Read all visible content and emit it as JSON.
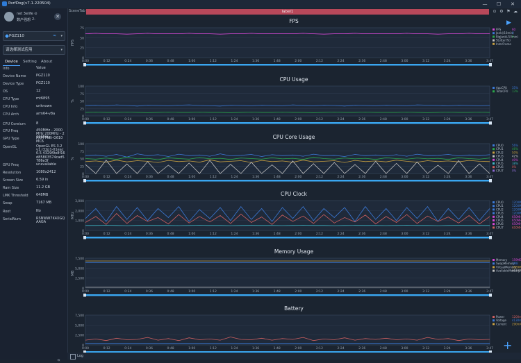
{
  "window": {
    "title": "PerfDog(v7.1.220504)",
    "minimize": "—",
    "maximize": "☐",
    "close": "✕"
  },
  "profile": {
    "name": "net 3elife ⊙",
    "sub": "数户强想 ",
    "right_mark": "2-",
    "close": "✕"
  },
  "device_select": {
    "value": "PGZ110",
    "dropdown": "▾"
  },
  "app_select": {
    "value": "请选择测试应用",
    "dropdown": "▾"
  },
  "tabs": [
    "Device",
    "Setting",
    "About"
  ],
  "info": {
    "header": {
      "k": "Info",
      "v": "Value"
    },
    "rows": [
      {
        "k": "Device Name",
        "v": "PGZ110"
      },
      {
        "k": "Device Type",
        "v": "PGZ110"
      },
      {
        "k": "OS",
        "v": "12"
      },
      {
        "k": "CPU Type",
        "v": "mt6895"
      },
      {
        "k": "CPU Info",
        "v": "unknown"
      },
      {
        "k": "CPU Arch",
        "v": "arm64-v8a"
      },
      {
        "k": "CPU Coreium",
        "v": "8"
      },
      {
        "k": "CPU Freq",
        "v": "450MHz - 2000MHz 200MHz - 2600MHz"
      },
      {
        "k": "GPU Type",
        "v": "ARM Mali-G610 MC6"
      },
      {
        "k": "OpenGL",
        "v": "OpenGL ES 3.2 v1.r32p1-01eac0.5 4329f9e8f16d85803574cad5786e3f"
      },
      {
        "k": "GPU Freq",
        "v": "unavailable"
      },
      {
        "k": "Resolution",
        "v": "1080x2412"
      },
      {
        "k": "Screen Size",
        "v": "6.59 in"
      },
      {
        "k": "Ram Size",
        "v": "11.2 GB"
      },
      {
        "k": "LMK Threshold",
        "v": "648MB"
      },
      {
        "k": "Swap",
        "v": "7167 MB"
      },
      {
        "k": "Root",
        "v": "No"
      },
      {
        "k": "SerialNum",
        "v": "RSNWW7K4XGQAAGA"
      }
    ]
  },
  "scene": {
    "label": "SceneTab",
    "bar_label": "label1"
  },
  "log": {
    "label": "Log"
  },
  "icons": {
    "play": "play-icon",
    "add": "add-icon",
    "collapse": "double-chevron-left-icon"
  },
  "time_ticks": [
    "0:00",
    "0:12",
    "0:24",
    "0:36",
    "0:48",
    "1:00",
    "1:12",
    "1:24",
    "1:36",
    "1:48",
    "2:00",
    "2:12",
    "2:24",
    "2:36",
    "2:48",
    "3:00",
    "3:12",
    "3:24",
    "3:36",
    "3:47"
  ],
  "charts": [
    {
      "title": "FPS",
      "ylabel": "FPS",
      "yticks": [
        "75",
        "50",
        "25",
        "0"
      ],
      "ymax": 75,
      "colors": [
        "#d648d6",
        "#3c7ad8",
        "#2aa84a"
      ],
      "series_values": [
        [
          60,
          61,
          60,
          60,
          59,
          60,
          61,
          60,
          60,
          60,
          61,
          60,
          60,
          59,
          60,
          60,
          61,
          60,
          60,
          60,
          60,
          61,
          60,
          59,
          60,
          60,
          61,
          60,
          60,
          60,
          60,
          61,
          60,
          60,
          59,
          60,
          60,
          61,
          60,
          60
        ]
      ],
      "legend": [
        "FPS",
        "Jank(/10min)",
        "BigJank(/10min)",
        "Stutter(%)",
        "InterFrame"
      ],
      "legend_colors": [
        "#d648d6",
        "#3c7ad8",
        "#2aa84a",
        "#c0c0c0",
        "#c8a040"
      ],
      "right_values": [
        "60",
        "0",
        "0"
      ]
    },
    {
      "title": "CPU Usage",
      "ylabel": "%",
      "yticks": [
        "100",
        "75",
        "50",
        "25",
        "0"
      ],
      "ymax": 100,
      "colors": [
        "#3c7ad8",
        "#2aa84a"
      ],
      "series_values": [
        [
          35,
          36,
          34,
          37,
          35,
          33,
          36,
          35,
          34,
          36,
          37,
          35,
          34,
          33,
          36,
          35,
          34,
          36,
          35,
          34,
          37,
          35,
          34,
          36,
          35,
          33,
          36,
          35,
          34,
          36,
          35,
          34,
          37,
          36,
          35,
          34,
          36,
          35,
          34,
          35
        ],
        [
          12,
          13,
          12,
          12,
          13,
          12,
          11,
          12,
          13,
          12,
          12,
          13,
          12,
          12,
          11,
          12,
          13,
          12,
          12,
          13,
          12,
          12,
          11,
          12,
          13,
          12,
          12,
          13,
          12,
          12,
          12,
          13,
          12,
          11,
          12,
          13,
          12,
          12,
          13,
          12
        ]
      ],
      "legend": [
        "AppCPU",
        "TotalCPU"
      ],
      "legend_colors": [
        "#3c7ad8",
        "#2aa84a"
      ],
      "right_values": [
        "35%",
        "13%"
      ]
    },
    {
      "title": "CPU Core Usage",
      "ylabel": "%",
      "yticks": [
        "100",
        "75",
        "50",
        "25",
        "0"
      ],
      "ymax": 100,
      "colors": [
        "#3c7ad8",
        "#2aa84a",
        "#c8a040",
        "#c0c0c0",
        "#d648d6",
        "#3fb8c8",
        "#d06060",
        "#8a6ad0"
      ],
      "series_values": [
        [
          60,
          62,
          58,
          64,
          55,
          66,
          60,
          63,
          57,
          65,
          60,
          62,
          58,
          66,
          59,
          61,
          64,
          57,
          63,
          60,
          62,
          58,
          65,
          60,
          61,
          57,
          64,
          60,
          62,
          59,
          63,
          58,
          65,
          60,
          61,
          64,
          59,
          62,
          60,
          63
        ],
        [
          50,
          48,
          52,
          47,
          55,
          49,
          51,
          46,
          53,
          50,
          48,
          54,
          49,
          51,
          47,
          52,
          50,
          48,
          53,
          49,
          51,
          47,
          55,
          50,
          48,
          52,
          49,
          51,
          47,
          53,
          50,
          48,
          52,
          49,
          51,
          47,
          53,
          50,
          48,
          52
        ],
        [
          40,
          42,
          38,
          45,
          39,
          43,
          41,
          37,
          44,
          40,
          42,
          38,
          46,
          39,
          41,
          43,
          37,
          44,
          40,
          42,
          38,
          45,
          39,
          41,
          43,
          37,
          44,
          40,
          42,
          39,
          45,
          41,
          38,
          43,
          40,
          42,
          39,
          44,
          41,
          40
        ],
        [
          30,
          0,
          45,
          0,
          32,
          0,
          40,
          0,
          28,
          0,
          35,
          0,
          44,
          0,
          31,
          0,
          38,
          0,
          29,
          0,
          42,
          0,
          33,
          0,
          37,
          0,
          30,
          0,
          41,
          0,
          34,
          0,
          39,
          0,
          28,
          0,
          43,
          0,
          32,
          0
        ]
      ],
      "legend": [
        "CPU0",
        "CPU1",
        "CPU2",
        "CPU3",
        "CPU4",
        "CPU5",
        "CPU6",
        "CPU7"
      ],
      "legend_colors": [
        "#3c7ad8",
        "#2aa84a",
        "#c8a040",
        "#c0c0c0",
        "#d648d6",
        "#3fb8c8",
        "#d06060",
        "#8a6ad0"
      ],
      "right_values": [
        "56%",
        "46%",
        "50%",
        "42%",
        "40%",
        "38%",
        "0%",
        "0%"
      ]
    },
    {
      "title": "CPU Clock",
      "ylabel": "MHz",
      "yticks": [
        "3,000",
        "2,000",
        "1,000",
        "0"
      ],
      "ymax": 3000,
      "colors": [
        "#3c7ad8",
        "#d06060",
        "#3fb8c8",
        "#c0c0c0"
      ],
      "series_values": [
        [
          1200,
          2200,
          900,
          2400,
          1100,
          2300,
          1000,
          2200,
          1300,
          2400,
          900,
          2100,
          1200,
          2300,
          1000,
          2400,
          1100,
          2200,
          900,
          2300,
          1200,
          2400,
          1000,
          2200,
          1300,
          2300,
          900,
          2400,
          1100,
          2200,
          1000,
          2300,
          1200,
          2400,
          900,
          2200,
          1100,
          2300,
          1000,
          2200
        ],
        [
          800,
          1400,
          600,
          1700,
          700,
          1500,
          900,
          1300,
          650,
          1600,
          750,
          1400,
          850,
          1500,
          700,
          1650,
          800,
          1350,
          600,
          1550,
          900,
          1450,
          700,
          1600,
          750,
          1300,
          850,
          1550,
          650,
          1400,
          800,
          1600,
          700,
          1450,
          900,
          1350,
          750,
          1500,
          650,
          1400
        ],
        [
          500,
          500,
          520,
          500,
          480,
          500,
          510,
          500,
          500,
          490,
          500,
          520,
          500,
          500,
          480,
          500,
          510,
          500,
          500,
          490,
          500,
          520,
          500,
          500,
          480,
          500,
          510,
          500,
          500,
          490,
          500,
          520,
          500,
          500,
          480,
          500,
          510,
          500,
          500,
          500
        ]
      ],
      "legend": [
        "CPU0",
        "CPU1",
        "CPU2",
        "CPU3",
        "CPU4",
        "CPU5",
        "CPU6",
        "CPU7"
      ],
      "legend_colors": [
        "#3c7ad8",
        "#3c7ad8",
        "#3c7ad8",
        "#3c7ad8",
        "#d648d6",
        "#d648d6",
        "#d648d6",
        "#d06060"
      ],
      "right_values": [
        "1200MHz",
        "1200MHz",
        "1200MHz",
        "1200MHz",
        "650MHz",
        "650MHz",
        "650MHz",
        "650MHz"
      ]
    },
    {
      "title": "Memory Usage",
      "ylabel": "MB",
      "yticks": [
        "7,500",
        "5,000",
        "2,500",
        "0"
      ],
      "ymax": 7500,
      "colors": [
        "#c8a040",
        "#3c7ad8",
        "#c0c0c0"
      ],
      "series_values": [
        [
          6800,
          6800,
          6800,
          6800,
          6800,
          6800,
          6800,
          6800,
          6800,
          6800,
          6800,
          6800,
          6800,
          6800,
          6800,
          6800,
          6800,
          6800,
          6800,
          6800,
          6800,
          6800,
          6800,
          6800,
          6800,
          6800,
          6800,
          6800,
          6800,
          6800,
          6800,
          6800,
          6800,
          6800,
          6800,
          6800,
          6800,
          6800,
          6800,
          6800
        ],
        [
          6400,
          6400,
          6400,
          6400,
          6400,
          6400,
          6400,
          6400,
          6400,
          6400,
          6400,
          6400,
          6400,
          6400,
          6400,
          6400,
          6400,
          6400,
          6400,
          6400,
          6400,
          6400,
          6400,
          6400,
          6400,
          6400,
          6400,
          6400,
          6400,
          6400,
          6400,
          6400,
          6400,
          6400,
          6400,
          6400,
          6400,
          6400,
          6400,
          6400
        ],
        [
          200,
          200,
          200,
          200,
          200,
          200,
          200,
          200,
          200,
          200,
          200,
          200,
          200,
          200,
          200,
          200,
          200,
          200,
          200,
          200,
          200,
          200,
          200,
          200,
          200,
          200,
          200,
          200,
          200,
          200,
          200,
          200,
          200,
          200,
          200,
          200,
          200,
          200,
          200,
          200
        ]
      ],
      "legend": [
        "Memory",
        "SwapMemory",
        "VirtualMemory",
        "AvailableMemory"
      ],
      "legend_colors": [
        "#d648d6",
        "#3c7ad8",
        "#c8a040",
        "#c0c0c0"
      ],
      "right_values": [
        "159MB",
        "1MB",
        "3889MB",
        "6174MB"
      ]
    },
    {
      "title": "Battery",
      "ylabel": "",
      "yticks": [
        "7,500",
        "5,000",
        "2,500",
        "0"
      ],
      "ymax": 7500,
      "colors": [
        "#d06060",
        "#3c7ad8"
      ],
      "series_values": [
        [
          1200,
          1500,
          1100,
          1700,
          1300,
          1400,
          1900,
          1200,
          1600,
          1100,
          1800,
          1300,
          1500,
          1200,
          2000,
          1400,
          1300,
          1700,
          1200,
          1600,
          1400,
          1900,
          1100,
          1500,
          1300,
          1800,
          1200,
          1600,
          1400,
          1700,
          1300,
          1500,
          1200,
          1900,
          1400,
          1600,
          1100,
          1500,
          1300,
          1400
        ],
        [
          400,
          400,
          400,
          400,
          400,
          400,
          400,
          400,
          400,
          400,
          400,
          400,
          400,
          400,
          400,
          400,
          400,
          400,
          400,
          400,
          400,
          400,
          400,
          400,
          400,
          400,
          400,
          400,
          400,
          400,
          400,
          400,
          400,
          400,
          400,
          400,
          400,
          400,
          400,
          400
        ]
      ],
      "legend": [
        "Power",
        "Voltage",
        "Current"
      ],
      "legend_colors": [
        "#d06060",
        "#3c7ad8",
        "#c8a040"
      ],
      "right_values": [
        "1200mW",
        "4130mV",
        "290mA"
      ]
    }
  ]
}
